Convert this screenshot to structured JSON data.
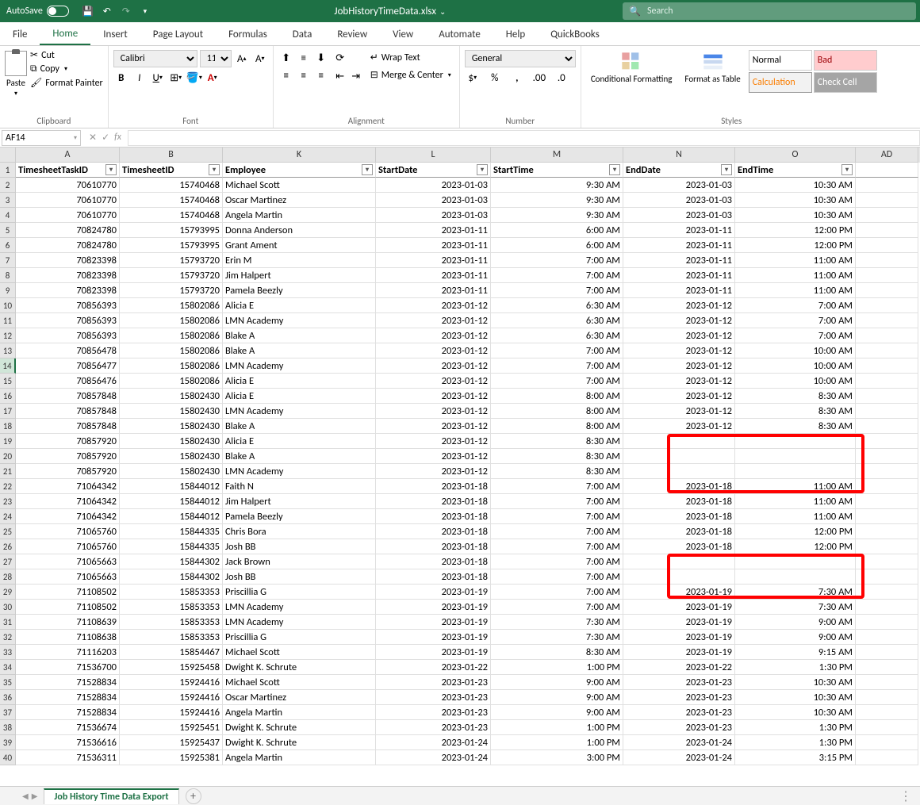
{
  "titlebar": {
    "autosave_label": "AutoSave",
    "filename": "JobHistoryTimeData.xlsx",
    "search_placeholder": "Search"
  },
  "tabs": [
    "File",
    "Home",
    "Insert",
    "Page Layout",
    "Formulas",
    "Data",
    "Review",
    "View",
    "Automate",
    "Help",
    "QuickBooks"
  ],
  "active_tab": "Home",
  "clipboard": {
    "paste": "Paste",
    "cut": "Cut",
    "copy": "Copy",
    "format_painter": "Format Painter",
    "group": "Clipboard"
  },
  "font": {
    "name": "Calibri",
    "size": "11",
    "group": "Font"
  },
  "alignment": {
    "wrap": "Wrap Text",
    "merge": "Merge & Center",
    "group": "Alignment"
  },
  "number": {
    "format": "General",
    "group": "Number"
  },
  "styles": {
    "cond": "Conditional Formatting",
    "table": "Format as Table",
    "normal": "Normal",
    "bad": "Bad",
    "calc": "Calculation",
    "check": "Check Cell",
    "group": "Styles"
  },
  "namebox": "AF14",
  "columns": [
    {
      "letter": "A",
      "width": "cA"
    },
    {
      "letter": "B",
      "width": "cB"
    },
    {
      "letter": "K",
      "width": "cK"
    },
    {
      "letter": "L",
      "width": "cL"
    },
    {
      "letter": "M",
      "width": "cM"
    },
    {
      "letter": "N",
      "width": "cN"
    },
    {
      "letter": "O",
      "width": "cO"
    },
    {
      "letter": "AD",
      "width": "cAD"
    }
  ],
  "headers": [
    "TimesheetTaskID",
    "TimesheetID",
    "Employee",
    "StartDate",
    "StartTime",
    "EndDate",
    "EndTime"
  ],
  "rows": [
    {
      "r": 2,
      "a": "70610770",
      "b": "15740468",
      "k": "Michael Scott",
      "l": "2023-01-03",
      "m": "9:30 AM",
      "n": "2023-01-03",
      "o": "10:30 AM"
    },
    {
      "r": 3,
      "a": "70610770",
      "b": "15740468",
      "k": "Oscar Martinez",
      "l": "2023-01-03",
      "m": "9:30 AM",
      "n": "2023-01-03",
      "o": "10:30 AM"
    },
    {
      "r": 4,
      "a": "70610770",
      "b": "15740468",
      "k": "Angela Martin",
      "l": "2023-01-03",
      "m": "9:30 AM",
      "n": "2023-01-03",
      "o": "10:30 AM"
    },
    {
      "r": 5,
      "a": "70824780",
      "b": "15793995",
      "k": "Donna Anderson",
      "l": "2023-01-11",
      "m": "6:00 AM",
      "n": "2023-01-11",
      "o": "12:00 PM"
    },
    {
      "r": 6,
      "a": "70824780",
      "b": "15793995",
      "k": "Grant Ament",
      "l": "2023-01-11",
      "m": "6:00 AM",
      "n": "2023-01-11",
      "o": "12:00 PM"
    },
    {
      "r": 7,
      "a": "70823398",
      "b": "15793720",
      "k": "Erin M",
      "l": "2023-01-11",
      "m": "7:00 AM",
      "n": "2023-01-11",
      "o": "11:00 AM"
    },
    {
      "r": 8,
      "a": "70823398",
      "b": "15793720",
      "k": "Jim Halpert",
      "l": "2023-01-11",
      "m": "7:00 AM",
      "n": "2023-01-11",
      "o": "11:00 AM"
    },
    {
      "r": 9,
      "a": "70823398",
      "b": "15793720",
      "k": "Pamela Beezly",
      "l": "2023-01-11",
      "m": "7:00 AM",
      "n": "2023-01-11",
      "o": "11:00 AM"
    },
    {
      "r": 10,
      "a": "70856393",
      "b": "15802086",
      "k": "Alicia E",
      "l": "2023-01-12",
      "m": "6:30 AM",
      "n": "2023-01-12",
      "o": "7:00 AM"
    },
    {
      "r": 11,
      "a": "70856393",
      "b": "15802086",
      "k": "LMN Academy",
      "l": "2023-01-12",
      "m": "6:30 AM",
      "n": "2023-01-12",
      "o": "7:00 AM"
    },
    {
      "r": 12,
      "a": "70856393",
      "b": "15802086",
      "k": "Blake A",
      "l": "2023-01-12",
      "m": "6:30 AM",
      "n": "2023-01-12",
      "o": "7:00 AM"
    },
    {
      "r": 13,
      "a": "70856478",
      "b": "15802086",
      "k": "Blake A",
      "l": "2023-01-12",
      "m": "7:00 AM",
      "n": "2023-01-12",
      "o": "10:00 AM"
    },
    {
      "r": 14,
      "a": "70856477",
      "b": "15802086",
      "k": "LMN Academy",
      "l": "2023-01-12",
      "m": "7:00 AM",
      "n": "2023-01-12",
      "o": "10:00 AM"
    },
    {
      "r": 15,
      "a": "70856476",
      "b": "15802086",
      "k": "Alicia E",
      "l": "2023-01-12",
      "m": "7:00 AM",
      "n": "2023-01-12",
      "o": "10:00 AM"
    },
    {
      "r": 16,
      "a": "70857848",
      "b": "15802430",
      "k": "Alicia E",
      "l": "2023-01-12",
      "m": "8:00 AM",
      "n": "2023-01-12",
      "o": "8:30 AM"
    },
    {
      "r": 17,
      "a": "70857848",
      "b": "15802430",
      "k": "LMN Academy",
      "l": "2023-01-12",
      "m": "8:00 AM",
      "n": "2023-01-12",
      "o": "8:30 AM"
    },
    {
      "r": 18,
      "a": "70857848",
      "b": "15802430",
      "k": "Blake A",
      "l": "2023-01-12",
      "m": "8:00 AM",
      "n": "2023-01-12",
      "o": "8:30 AM"
    },
    {
      "r": 19,
      "a": "70857920",
      "b": "15802430",
      "k": "Alicia E",
      "l": "2023-01-12",
      "m": "8:30 AM",
      "n": "",
      "o": ""
    },
    {
      "r": 20,
      "a": "70857920",
      "b": "15802430",
      "k": "Blake A",
      "l": "2023-01-12",
      "m": "8:30 AM",
      "n": "",
      "o": ""
    },
    {
      "r": 21,
      "a": "70857920",
      "b": "15802430",
      "k": "LMN Academy",
      "l": "2023-01-12",
      "m": "8:30 AM",
      "n": "",
      "o": ""
    },
    {
      "r": 22,
      "a": "71064342",
      "b": "15844012",
      "k": "Faith  N",
      "l": "2023-01-18",
      "m": "7:00 AM",
      "n": "2023-01-18",
      "o": "11:00 AM"
    },
    {
      "r": 23,
      "a": "71064342",
      "b": "15844012",
      "k": "Jim Halpert",
      "l": "2023-01-18",
      "m": "7:00 AM",
      "n": "2023-01-18",
      "o": "11:00 AM"
    },
    {
      "r": 24,
      "a": "71064342",
      "b": "15844012",
      "k": "Pamela Beezly",
      "l": "2023-01-18",
      "m": "7:00 AM",
      "n": "2023-01-18",
      "o": "11:00 AM"
    },
    {
      "r": 25,
      "a": "71065760",
      "b": "15844335",
      "k": "Chris Bora",
      "l": "2023-01-18",
      "m": "7:00 AM",
      "n": "2023-01-18",
      "o": "12:00 PM"
    },
    {
      "r": 26,
      "a": "71065760",
      "b": "15844335",
      "k": "Josh BB",
      "l": "2023-01-18",
      "m": "7:00 AM",
      "n": "2023-01-18",
      "o": "12:00 PM"
    },
    {
      "r": 27,
      "a": "71065663",
      "b": "15844302",
      "k": "Jack Brown",
      "l": "2023-01-18",
      "m": "7:00 AM",
      "n": "",
      "o": ""
    },
    {
      "r": 28,
      "a": "71065663",
      "b": "15844302",
      "k": "Josh BB",
      "l": "2023-01-18",
      "m": "7:00 AM",
      "n": "",
      "o": ""
    },
    {
      "r": 29,
      "a": "71108502",
      "b": "15853353",
      "k": "Priscillia G",
      "l": "2023-01-19",
      "m": "7:00 AM",
      "n": "2023-01-19",
      "o": "7:30 AM"
    },
    {
      "r": 30,
      "a": "71108502",
      "b": "15853353",
      "k": "LMN Academy",
      "l": "2023-01-19",
      "m": "7:00 AM",
      "n": "2023-01-19",
      "o": "7:30 AM"
    },
    {
      "r": 31,
      "a": "71108639",
      "b": "15853353",
      "k": "LMN Academy",
      "l": "2023-01-19",
      "m": "7:30 AM",
      "n": "2023-01-19",
      "o": "9:00 AM"
    },
    {
      "r": 32,
      "a": "71108638",
      "b": "15853353",
      "k": "Priscillia G",
      "l": "2023-01-19",
      "m": "7:30 AM",
      "n": "2023-01-19",
      "o": "9:00 AM"
    },
    {
      "r": 33,
      "a": "71116203",
      "b": "15854467",
      "k": "Michael  Scott",
      "l": "2023-01-19",
      "m": "8:30 AM",
      "n": "2023-01-19",
      "o": "9:15 AM"
    },
    {
      "r": 34,
      "a": "71536700",
      "b": "15925458",
      "k": "Dwight  K. Schrute",
      "l": "2023-01-22",
      "m": "1:00 PM",
      "n": "2023-01-22",
      "o": "1:30 PM"
    },
    {
      "r": 35,
      "a": "71528834",
      "b": "15924416",
      "k": "Michael  Scott",
      "l": "2023-01-23",
      "m": "9:00 AM",
      "n": "2023-01-23",
      "o": "10:30 AM"
    },
    {
      "r": 36,
      "a": "71528834",
      "b": "15924416",
      "k": "Oscar Martinez",
      "l": "2023-01-23",
      "m": "9:00 AM",
      "n": "2023-01-23",
      "o": "10:30 AM"
    },
    {
      "r": 37,
      "a": "71528834",
      "b": "15924416",
      "k": "Angela Martin",
      "l": "2023-01-23",
      "m": "9:00 AM",
      "n": "2023-01-23",
      "o": "10:30 AM"
    },
    {
      "r": 38,
      "a": "71536674",
      "b": "15925451",
      "k": "Dwight  K. Schrute",
      "l": "2023-01-23",
      "m": "1:00 PM",
      "n": "2023-01-23",
      "o": "1:30 PM"
    },
    {
      "r": 39,
      "a": "71536616",
      "b": "15925437",
      "k": "Dwight  K. Schrute",
      "l": "2023-01-24",
      "m": "1:00 PM",
      "n": "2023-01-24",
      "o": "1:30 PM"
    },
    {
      "r": 40,
      "a": "71536311",
      "b": "15925381",
      "k": "Angela Martin",
      "l": "2023-01-24",
      "m": "3:00 PM",
      "n": "2023-01-24",
      "o": "3:15 PM"
    }
  ],
  "active_row": 14,
  "sheet_tab": "Job History Time Data Export"
}
